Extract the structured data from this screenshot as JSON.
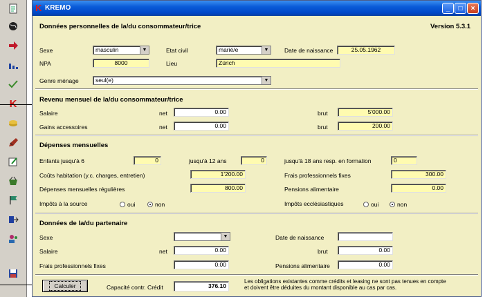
{
  "window": {
    "title": "KREMO"
  },
  "toolbar": {
    "icons": [
      "document-icon",
      "globe-icon",
      "arrow-icon",
      "bar-chart-icon",
      "checkmark-icon",
      "kremo-k-icon",
      "coins-icon",
      "pencil-icon",
      "edit-icon",
      "basket-icon",
      "flag-icon",
      "transfer-icon",
      "people-icon",
      "save-icon"
    ]
  },
  "personal": {
    "title": "Données personnelles de la/du consommateur/trice",
    "version": "Version  5.3.1",
    "sexe_label": "Sexe",
    "sexe_value": "masculin",
    "etat_label": "Etat civil",
    "etat_value": "marié/e",
    "naissance_label": "Date de naissance",
    "naissance_value": "25.05.1962",
    "npa_label": "NPA",
    "npa_value": "8000",
    "lieu_label": "Lieu",
    "lieu_value": "Zürich",
    "menage_label": "Genre ménage",
    "menage_value": "seul(e)"
  },
  "revenu": {
    "title": "Revenu mensuel de la/du consommateur/trice",
    "salaire_label": "Salaire",
    "net_label": "net",
    "brut_label": "brut",
    "salaire_net": "0.00",
    "salaire_brut": "5'000.00",
    "gains_label": "Gains accessoires",
    "gains_net": "0.00",
    "gains_brut": "200.00"
  },
  "depenses": {
    "title": "Dépenses mensuelles",
    "enfants6_label": "Enfants jusqu'à 6",
    "enfants6": "0",
    "enfants12_label": "jusqu'à 12 ans",
    "enfants12": "0",
    "enfants18_label": "jusqu'à 18 ans resp. en formation",
    "enfants18": "0",
    "habitation_label": "Coûts habitation (y.c. charges, entretien)",
    "habitation": "1'200.00",
    "frais_label": "Frais professionnels fixes",
    "frais": "300.00",
    "regulieres_label": "Dépenses mensuelles régulières",
    "regulieres": "800.00",
    "pensions_label": "Pensions alimentaire",
    "pensions": "0.00",
    "impot_source_label": "Impôts à la source",
    "oui": "oui",
    "non": "non",
    "impot_eccl_label": "Impôts ecclésiastiques"
  },
  "partenaire": {
    "title": "Données de la/du partenaire",
    "sexe_label": "Sexe",
    "sexe_value": "",
    "naissance_label": "Date de naissance",
    "naissance_value": "",
    "salaire_label": "Salaire",
    "net_label": "net",
    "salaire_net": "0.00",
    "brut_label": "brut",
    "salaire_brut": "0.00",
    "frais_label": "Frais professionnels fixes",
    "frais": "0.00",
    "pensions_label": "Pensions alimentaire",
    "pensions": "0.00"
  },
  "footer": {
    "calculer": "Calculer",
    "capacite_label": "Capacité contr. Crédit",
    "capacite_value": "376.10",
    "note": "Les obligations existantes comme crédits et leasing ne sont pas tenues en compte et doivent être déduites du montant disponible au cas par cas."
  }
}
